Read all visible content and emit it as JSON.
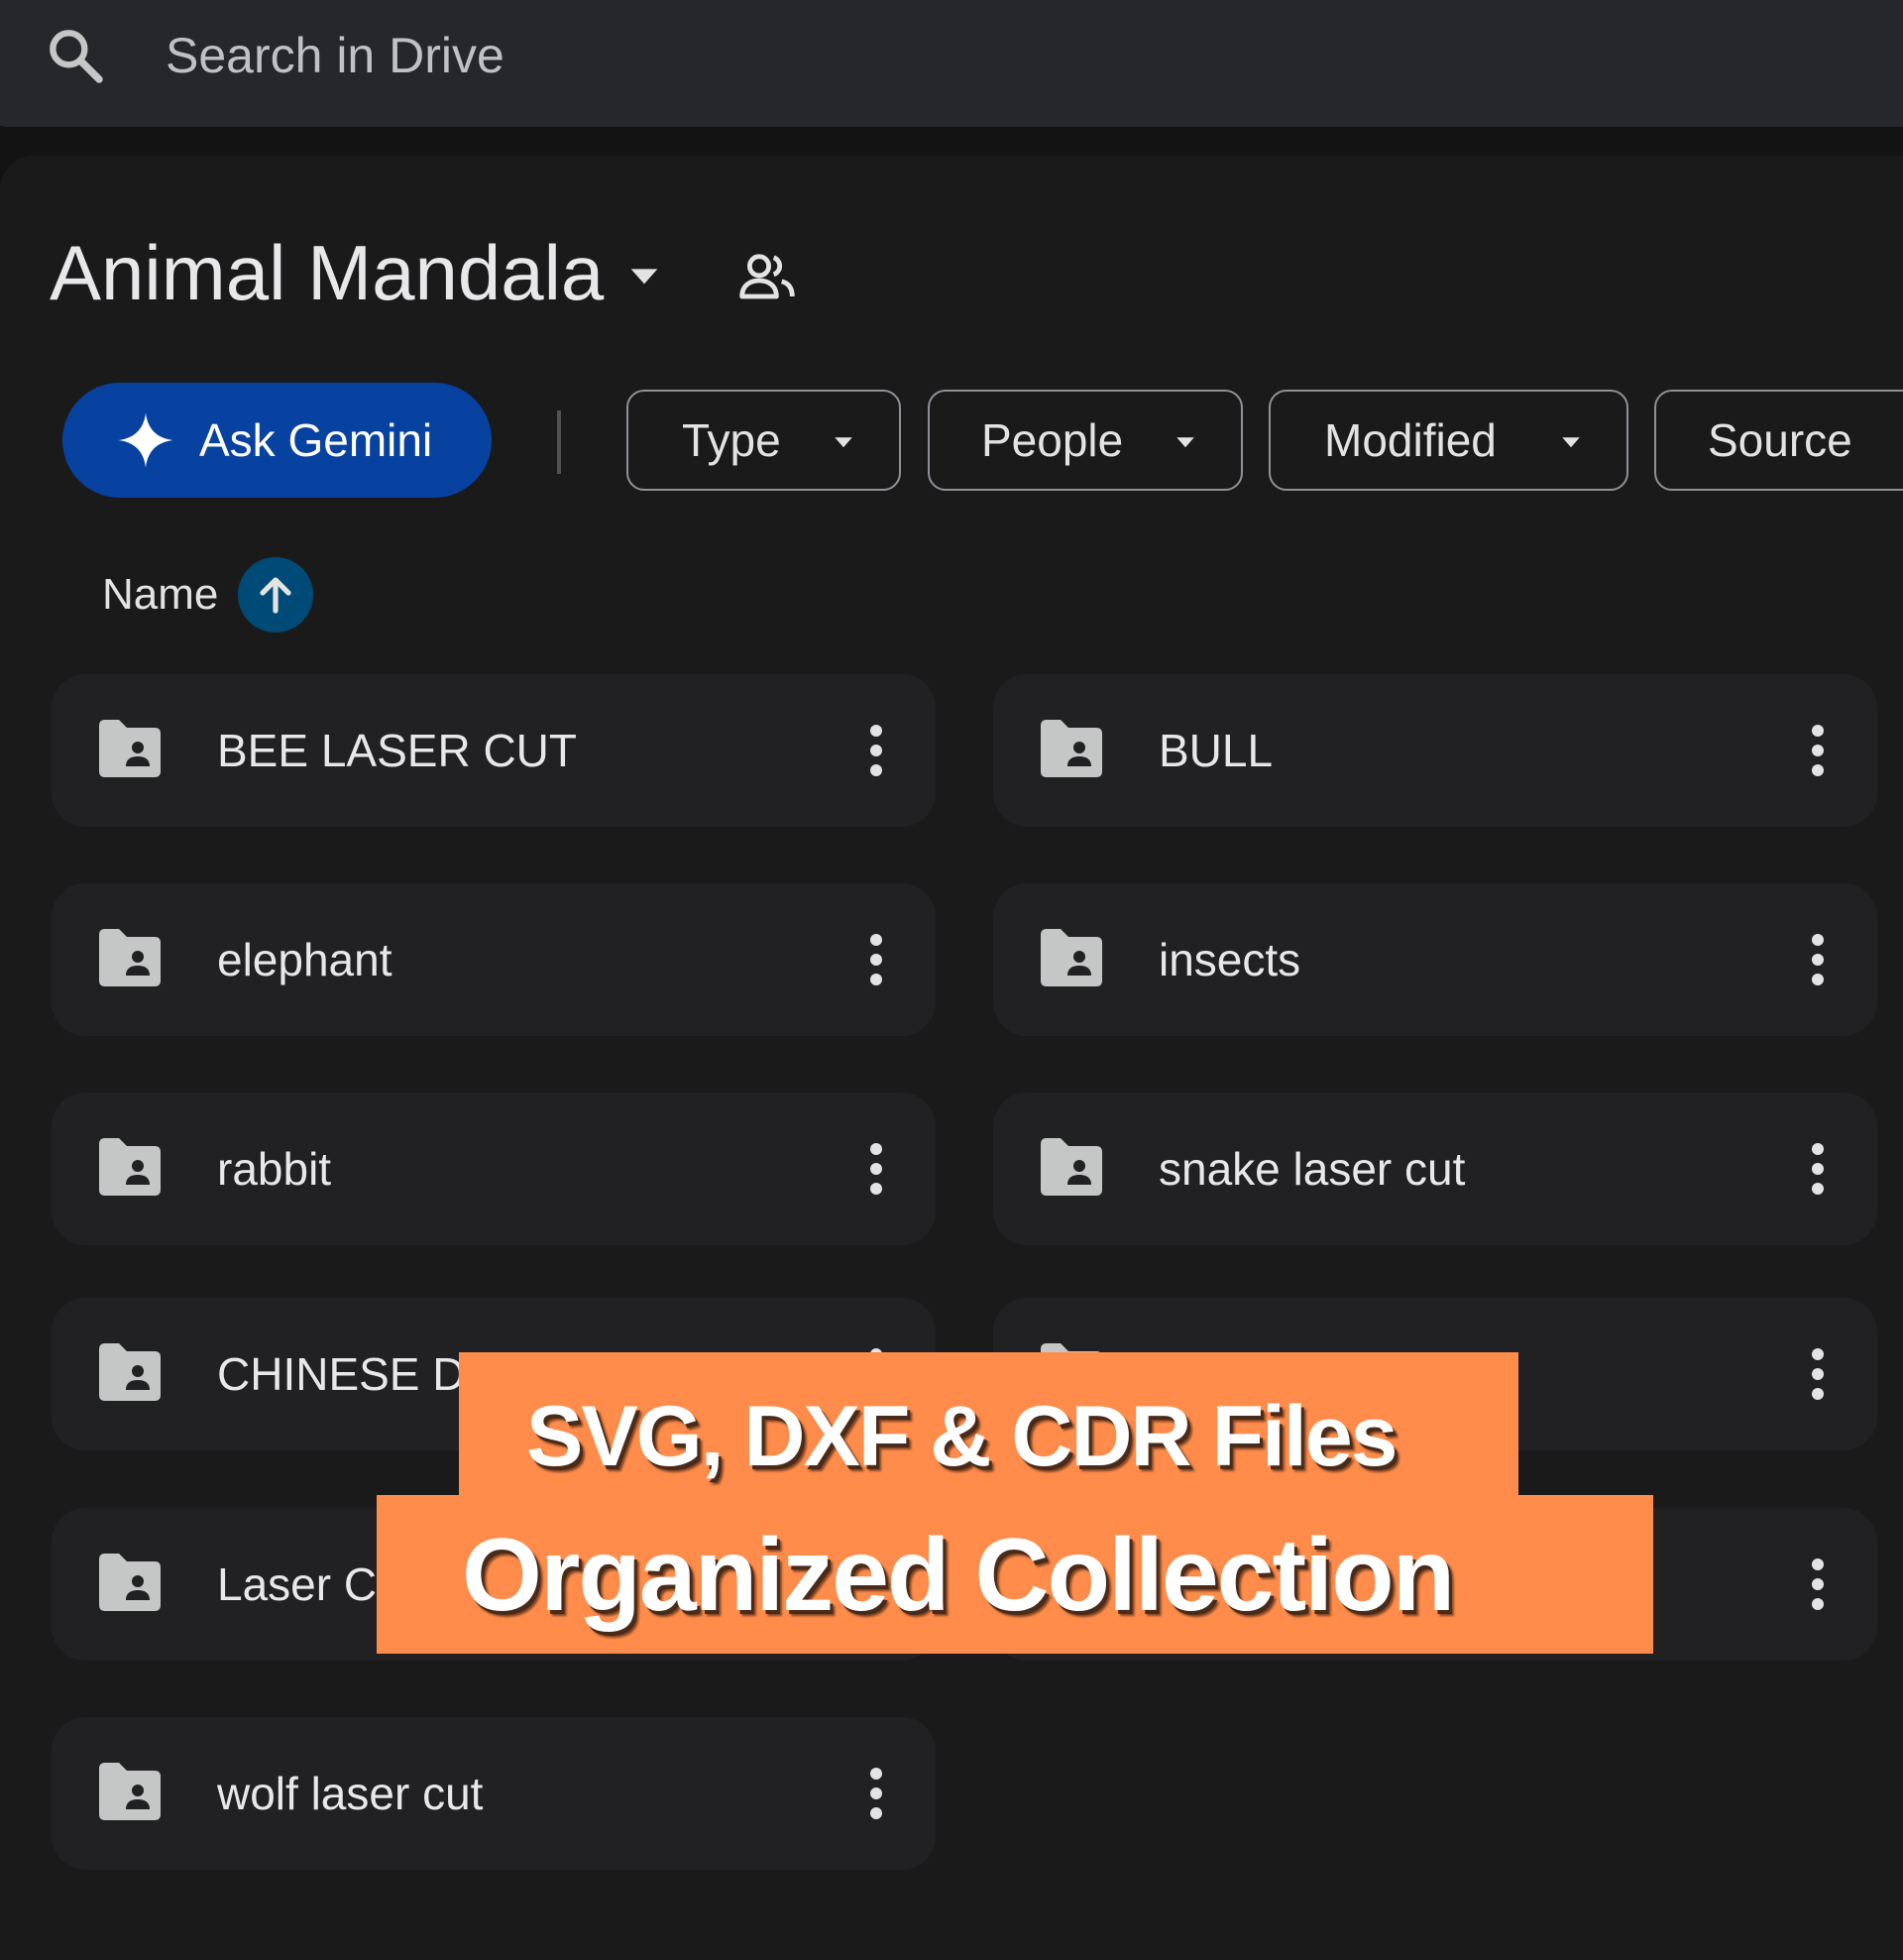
{
  "search": {
    "placeholder": "Search in Drive"
  },
  "folder": {
    "title": "Animal Mandala"
  },
  "toolbar": {
    "gemini_label": "Ask Gemini",
    "filters": [
      "Type",
      "People",
      "Modified",
      "Source"
    ]
  },
  "sort": {
    "label": "Name",
    "direction": "ascending"
  },
  "items": [
    {
      "name": "BEE LASER CUT"
    },
    {
      "name": "BULL"
    },
    {
      "name": "elephant"
    },
    {
      "name": "insects"
    },
    {
      "name": "rabbit"
    },
    {
      "name": "snake laser cut"
    },
    {
      "name": "CHINESE DR"
    },
    {
      "name": ""
    },
    {
      "name": "Laser Cu"
    },
    {
      "name": ""
    },
    {
      "name": "wolf laser cut"
    }
  ],
  "overlay": {
    "line1": "SVG, DXF & CDR Files",
    "line2": "Organized Collection"
  },
  "colors": {
    "background": "#131314",
    "panel": "#1a1a1b",
    "tile": "#212124",
    "gemini": "#0842a0",
    "banner": "#ff8c4a"
  }
}
